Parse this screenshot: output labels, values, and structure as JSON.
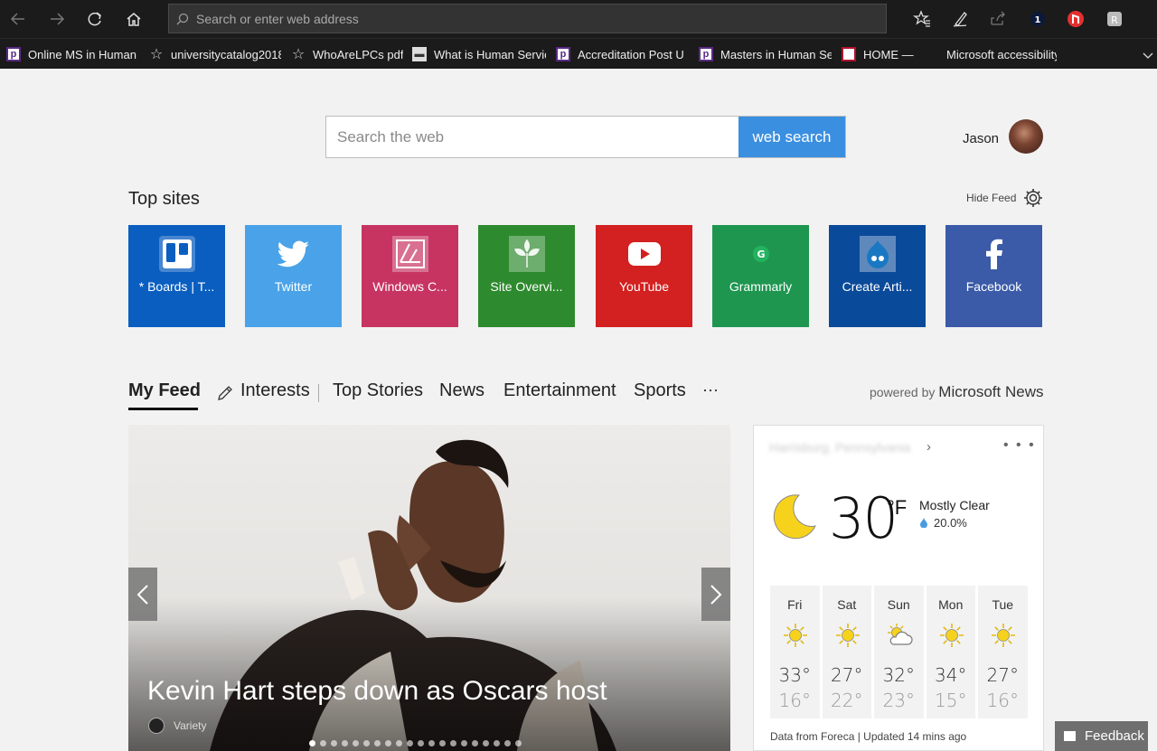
{
  "browser": {
    "address_placeholder": "Search or enter web address",
    "icons": [
      "back-icon",
      "forward-icon",
      "refresh-icon",
      "home-icon",
      "favorites-icon",
      "pen-icon",
      "share-icon",
      "extension-1password-icon",
      "extension-adblock-icon",
      "extension-r-icon"
    ]
  },
  "bookmarks": [
    {
      "label": "Online MS in Human",
      "icon": "p"
    },
    {
      "label": "universitycatalog2018",
      "icon": "star"
    },
    {
      "label": "WhoAreLPCs pdf",
      "icon": "star"
    },
    {
      "label": "What is Human Servic",
      "icon": "doc"
    },
    {
      "label": "Accreditation  Post U",
      "icon": "p"
    },
    {
      "label": "Masters in Human Se",
      "icon": "p"
    },
    {
      "label": "HOME —",
      "icon": "red"
    },
    {
      "label": "Microsoft accessibility",
      "icon": "ms"
    }
  ],
  "search": {
    "placeholder": "Search the web",
    "button_label": "web search"
  },
  "user": {
    "name": "Jason"
  },
  "top_sites": {
    "title": "Top sites",
    "hide_feed_label": "Hide Feed",
    "tiles": [
      {
        "label": "* Boards | T...",
        "color": "#0a5ec0",
        "icon": "trello-icon"
      },
      {
        "label": "Twitter",
        "color": "#4aa3e8",
        "icon": "twitter-icon"
      },
      {
        "label": "Windows C...",
        "color": "#c73462",
        "icon": "windows-central-icon"
      },
      {
        "label": "Site Overvi...",
        "color": "#2e8a2e",
        "icon": "site-overview-icon"
      },
      {
        "label": "YouTube",
        "color": "#d32020",
        "icon": "youtube-icon"
      },
      {
        "label": "Grammarly",
        "color": "#1e9650",
        "icon": "grammarly-icon"
      },
      {
        "label": "Create Arti...",
        "color": "#0a4a9a",
        "icon": "drupal-icon"
      },
      {
        "label": "Facebook",
        "color": "#3b5ba8",
        "icon": "facebook-icon"
      }
    ]
  },
  "feed_nav": {
    "items": [
      "My Feed",
      "Interests",
      "Top Stories",
      "News",
      "Entertainment",
      "Sports",
      "···"
    ],
    "powered_prefix": "powered by",
    "powered_brand": "Microsoft News"
  },
  "hero": {
    "title": "Kevin Hart steps down as Oscars host",
    "source": "Variety",
    "slide_count": 20,
    "active_slide": 1
  },
  "weather": {
    "location": "Harrisburg, Pennsylvania",
    "temp": "30",
    "unit": "°F",
    "condition": "Mostly Clear",
    "precip": "20.0%",
    "forecast": [
      {
        "day": "Fri",
        "hi": "33°",
        "lo": "16°",
        "icon": "sunny-icon"
      },
      {
        "day": "Sat",
        "hi": "27°",
        "lo": "22°",
        "icon": "sunny-icon"
      },
      {
        "day": "Sun",
        "hi": "32°",
        "lo": "23°",
        "icon": "partly-cloudy-icon"
      },
      {
        "day": "Mon",
        "hi": "34°",
        "lo": "15°",
        "icon": "sunny-icon"
      },
      {
        "day": "Tue",
        "hi": "27°",
        "lo": "16°",
        "icon": "sunny-icon"
      }
    ],
    "footer": "Data from Foreca | Updated 14 mins ago"
  },
  "feedback_label": "Feedback"
}
